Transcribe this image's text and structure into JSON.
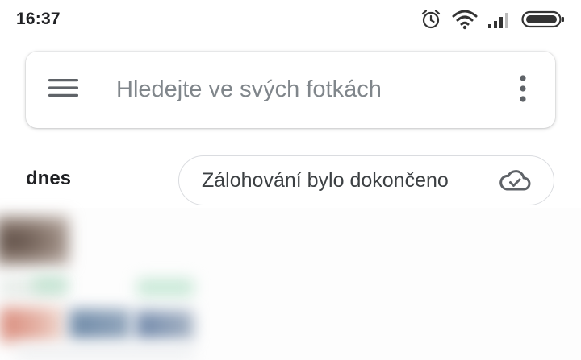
{
  "status_bar": {
    "time": "16:37",
    "icons": [
      "alarm-icon",
      "wifi-icon",
      "signal-icon",
      "battery-icon"
    ]
  },
  "search": {
    "placeholder": "Hledejte ve svých fotkách",
    "value": "",
    "menu_icon": "hamburger-menu-icon",
    "more_icon": "more-vert-icon"
  },
  "section": {
    "label": "dnes"
  },
  "backup_status": {
    "label": "Zálohování bylo dokončeno",
    "icon": "cloud-done-icon"
  },
  "colors": {
    "background": "#ffffff",
    "text_primary": "#202124",
    "text_secondary": "#80868b",
    "chip_border": "#dadce0"
  }
}
